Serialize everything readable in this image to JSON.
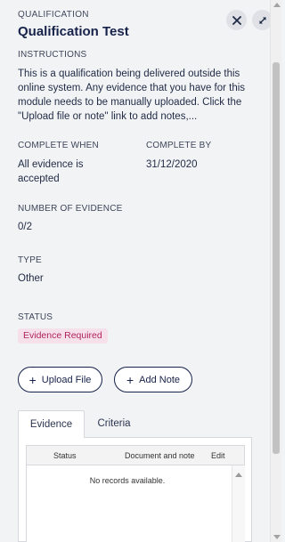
{
  "header": {
    "eyebrow": "QUALIFICATION",
    "title": "Qualification Test",
    "close_icon": "close-icon",
    "expand_icon": "expand-icon"
  },
  "instructions": {
    "label": "INSTRUCTIONS",
    "text": "This is a qualification being delivered outside this online system. Any evidence that you have for this module needs to be manually uploaded. Click the \"Upload file or note\" link to add notes,..."
  },
  "complete_when": {
    "label": "COMPLETE WHEN",
    "value": "All evidence is accepted"
  },
  "complete_by": {
    "label": "COMPLETE BY",
    "value": "31/12/2020"
  },
  "evidence_count": {
    "label": "NUMBER OF EVIDENCE",
    "value": "0/2"
  },
  "type": {
    "label": "TYPE",
    "value": "Other"
  },
  "status": {
    "label": "STATUS",
    "badge": "Evidence Required"
  },
  "actions": {
    "upload_label": "Upload File",
    "note_label": "Add Note",
    "plus": "+"
  },
  "tabs": [
    {
      "label": "Evidence"
    },
    {
      "label": "Criteria"
    }
  ],
  "grid": {
    "columns": [
      "Status",
      "Document and note",
      "Edit"
    ],
    "empty_message": "No records available."
  },
  "colors": {
    "background": "#f2f3f5",
    "title": "#17224a",
    "badge_bg": "#f6e1ea",
    "badge_text": "#b0245e"
  }
}
